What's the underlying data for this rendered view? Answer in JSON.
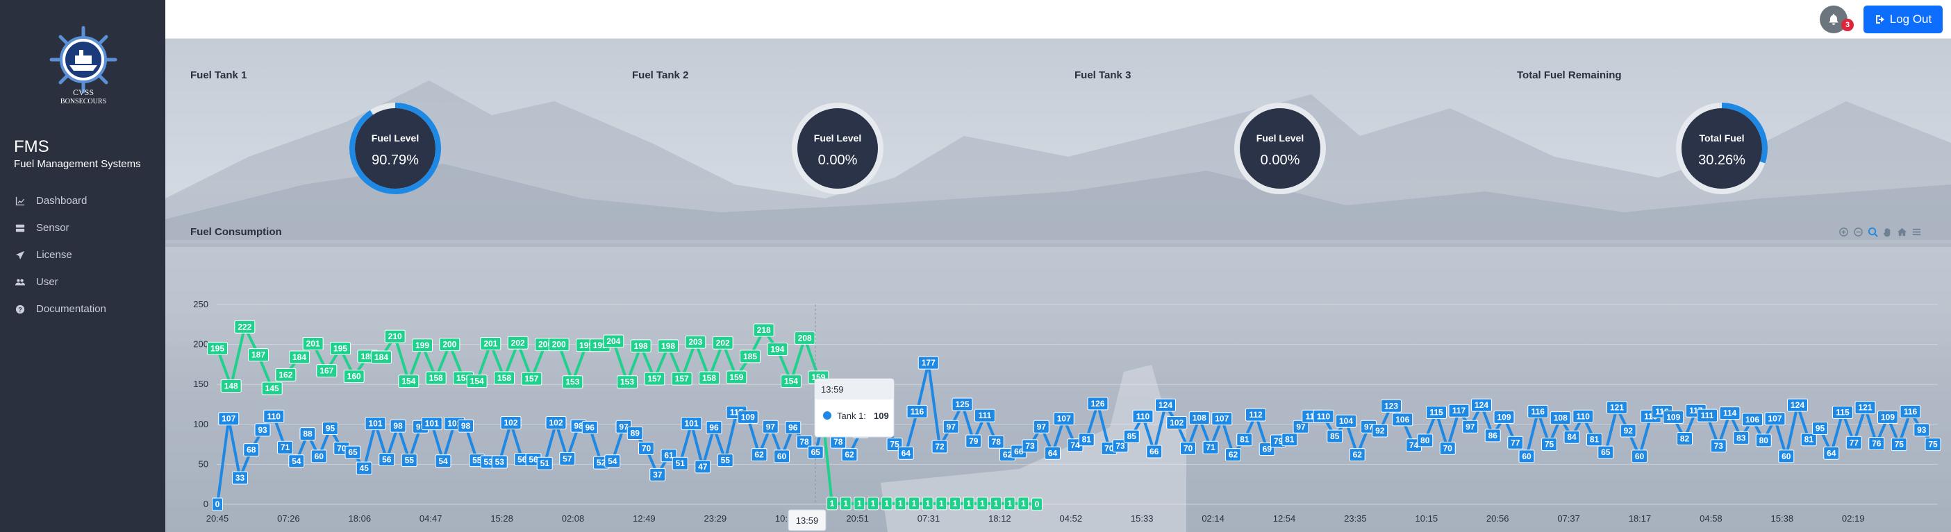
{
  "sidebar": {
    "logo_text": "CVSS",
    "logo_sub": "BONSECOURS",
    "title": "FMS",
    "subtitle": "Fuel Management Systems",
    "items": [
      {
        "label": "Dashboard",
        "icon": "chart-line-icon"
      },
      {
        "label": "Sensor",
        "icon": "server-icon"
      },
      {
        "label": "License",
        "icon": "paper-plane-icon"
      },
      {
        "label": "User",
        "icon": "users-icon"
      },
      {
        "label": "Documentation",
        "icon": "question-circle-icon"
      }
    ]
  },
  "topbar": {
    "notification_count": "3",
    "logout_label": "Log Out"
  },
  "gauges": [
    {
      "card_title": "Fuel Tank 1",
      "inner_title": "Fuel Level",
      "value_text": "90.79%",
      "fraction": 0.9079
    },
    {
      "card_title": "Fuel Tank 2",
      "inner_title": "Fuel Level",
      "value_text": "0.00%",
      "fraction": 0.0
    },
    {
      "card_title": "Fuel Tank 3",
      "inner_title": "Fuel Level",
      "value_text": "0.00%",
      "fraction": 0.0
    },
    {
      "card_title": "Total Fuel Remaining",
      "inner_title": "Total Fuel",
      "value_text": "30.26%",
      "fraction": 0.3026
    }
  ],
  "colors": {
    "tank1": "#1e88e5",
    "tank2": "#1fd18c",
    "gauge_fill": "#1e88e5",
    "gauge_bg": "#2a3347",
    "sidebar": "#2a303d",
    "primary_button": "#0d6efd"
  },
  "chart_section": {
    "title": "Fuel Consumption"
  },
  "chart_data": {
    "type": "line",
    "title": "",
    "xlabel": "",
    "ylabel": "",
    "ylim": [
      0,
      250
    ],
    "y_ticks": [
      "0",
      "50",
      "100",
      "150",
      "200",
      "250"
    ],
    "x_tick_labels": [
      "20:45",
      "07:26",
      "18:06",
      "04:47",
      "15:28",
      "02:08",
      "12:49",
      "23:29",
      "10:10",
      "20:51",
      "07:31",
      "18:12",
      "04:52",
      "15:33",
      "02:14",
      "12:54",
      "23:35",
      "10:15",
      "20:56",
      "07:37",
      "18:17",
      "04:58",
      "15:38",
      "02:19"
    ],
    "grid": true,
    "legend": "bottom-center",
    "series": [
      {
        "name": "Tank 1",
        "values": [
          0,
          107,
          33,
          68,
          93,
          110,
          71,
          54,
          88,
          60,
          95,
          70,
          65,
          45,
          101,
          56,
          98,
          55,
          97,
          101,
          54,
          101,
          98,
          55,
          53,
          53,
          102,
          56,
          56,
          51,
          102,
          57,
          98,
          96,
          52,
          54,
          97,
          89,
          70,
          37,
          61,
          51,
          101,
          47,
          96,
          55,
          115,
          109,
          62,
          97,
          60,
          96,
          78,
          65,
          122,
          78,
          62,
          91,
          98,
          123,
          75,
          64,
          116,
          177,
          72,
          97,
          125,
          79,
          111,
          78,
          62,
          66,
          73,
          97,
          64,
          107,
          74,
          81,
          126,
          70,
          73,
          85,
          110,
          66,
          124,
          102,
          70,
          108,
          71,
          107,
          62,
          81,
          112,
          69,
          79,
          81,
          97,
          110,
          110,
          85,
          104,
          62,
          97,
          92,
          123,
          106,
          74,
          80,
          115,
          70,
          117,
          97,
          124,
          86,
          109,
          77,
          60,
          116,
          75,
          108,
          84,
          110,
          81,
          65,
          121,
          92,
          60,
          110,
          116,
          109,
          82,
          117,
          111,
          73,
          114,
          83,
          106,
          80,
          107,
          60,
          124,
          81,
          95,
          64,
          115,
          77,
          121,
          76,
          109,
          75,
          116,
          93,
          75
        ],
        "labeled_points": [
          {
            "x": "20:45",
            "y": 0
          },
          {
            "x": "07:26",
            "y": 88
          },
          {
            "x": "18:06",
            "y": 101
          },
          {
            "x": "04:47",
            "y": 98
          },
          {
            "x": "15:28",
            "y": 102
          },
          {
            "x": "02:08",
            "y": 98
          },
          {
            "x": "12:49",
            "y": 101
          },
          {
            "x": "23:29",
            "y": 115
          },
          {
            "x": "13:59",
            "y": 109
          },
          {
            "x": "20:51",
            "y": 96
          },
          {
            "x": "07:31",
            "y": 91
          },
          {
            "x": "18:12",
            "y": 125
          },
          {
            "x": "15:33",
            "y": 126
          },
          {
            "x": "02:14",
            "y": 108
          },
          {
            "x": "12:54",
            "y": 107
          },
          {
            "x": "23:35",
            "y": 110
          },
          {
            "x": "10:15",
            "y": 123
          },
          {
            "x": "20:56",
            "y": 124
          },
          {
            "x": "07:37",
            "y": 116
          },
          {
            "x": "18:17",
            "y": 121
          },
          {
            "x": "04:58",
            "y": 117
          },
          {
            "x": "15:38",
            "y": 106
          },
          {
            "x": "02:19",
            "y": 121
          }
        ]
      },
      {
        "name": "Tank 2",
        "values": [
          195,
          148,
          222,
          187,
          145,
          162,
          184,
          201,
          167,
          195,
          160,
          185,
          184,
          210,
          154,
          199,
          158,
          200,
          158,
          154,
          201,
          158,
          202,
          157,
          200,
          200,
          153,
          199,
          199,
          204,
          153,
          198,
          157,
          198,
          157,
          203,
          158,
          202,
          159,
          185,
          218,
          194,
          154,
          208,
          159,
          1,
          1,
          1,
          1,
          1,
          1,
          1,
          1,
          1,
          1,
          1,
          1,
          1,
          1,
          1,
          0
        ],
        "labeled_points": [
          {
            "x": "20:45",
            "y": 195
          },
          {
            "x": "07:26",
            "y": 195
          },
          {
            "x": "18:06",
            "y": 200
          },
          {
            "x": "04:47",
            "y": 201
          },
          {
            "x": "15:28",
            "y": 199
          },
          {
            "x": "02:08",
            "y": 203
          },
          {
            "x": "12:49",
            "y": 208
          },
          {
            "x": "23:29",
            "y": 1
          },
          {
            "x": "07:31",
            "y": 1
          },
          {
            "x": "18:12",
            "y": 1
          },
          {
            "x": "04:52",
            "y": 0
          }
        ]
      }
    ],
    "tooltip": {
      "time": "13:59",
      "series": "Tank 1:",
      "value": "109",
      "crosshair_label": "13:59"
    }
  }
}
